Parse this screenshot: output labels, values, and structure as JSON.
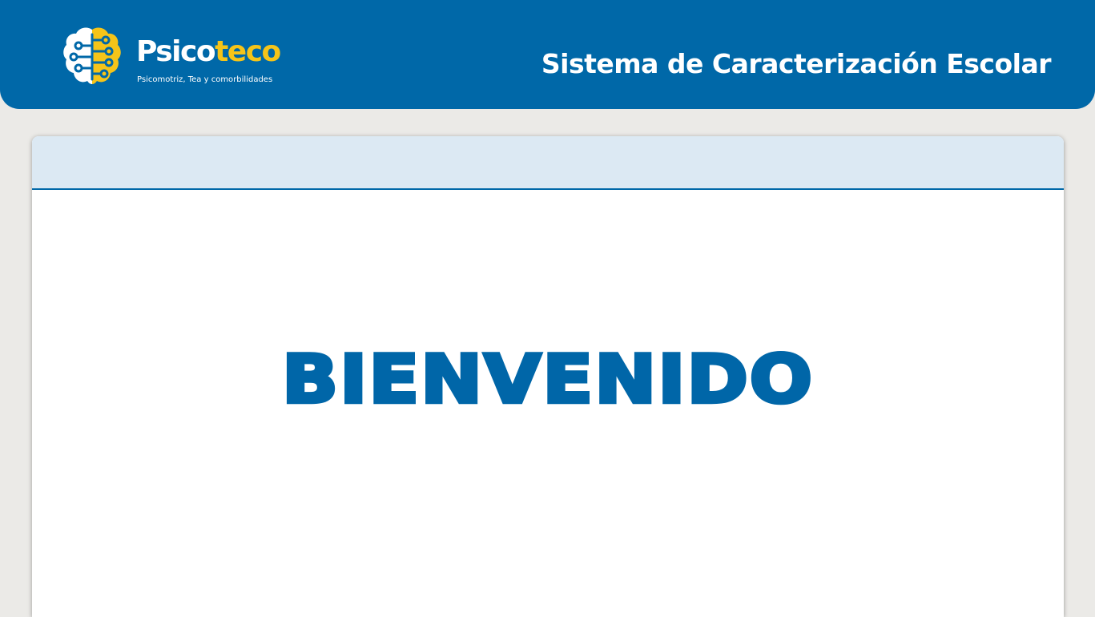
{
  "header": {
    "logo": {
      "brand_part1": "Psico",
      "brand_part2": "teco",
      "tagline": "Psicomotriz, Tea y comorbilidades",
      "icon": "brain-circuit-icon"
    },
    "system_title": "Sistema de Caracterización Escolar"
  },
  "main": {
    "card_header_title": "",
    "welcome_text": "BIENVENIDO"
  },
  "colors": {
    "primary": "#0068a8",
    "accent": "#f5c419",
    "background": "#ebeae7",
    "card_header": "#dce9f3"
  }
}
